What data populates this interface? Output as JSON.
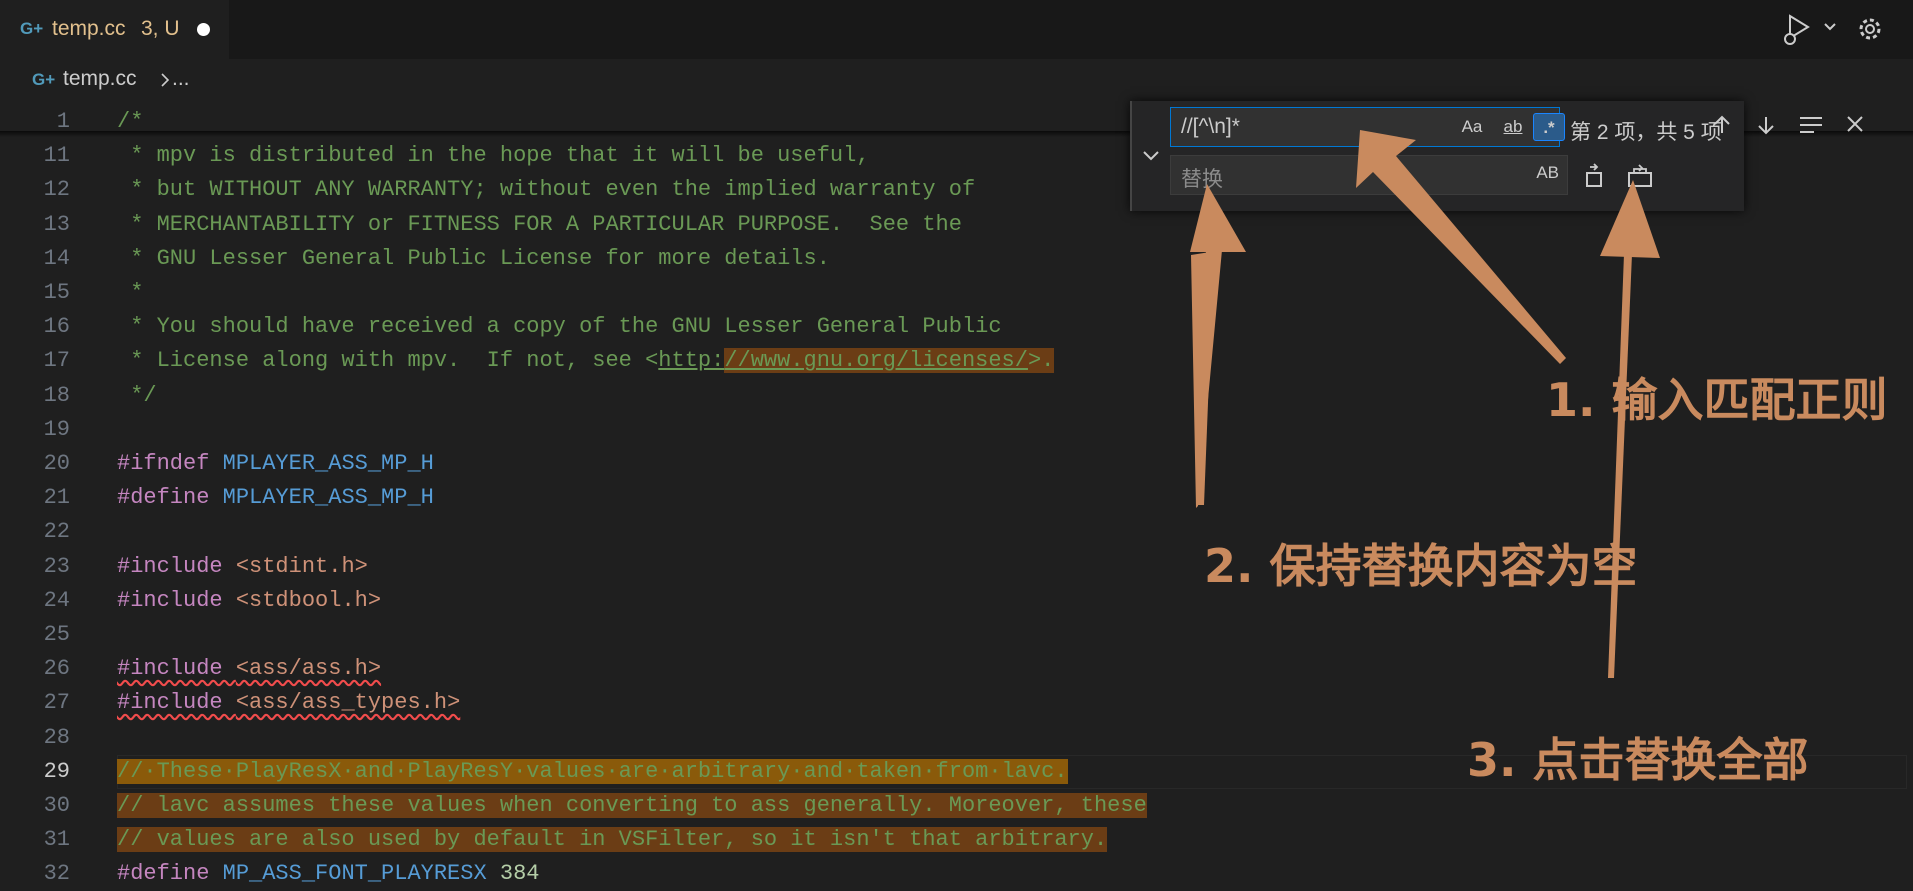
{
  "tab": {
    "icon": "C++-file-icon",
    "icon_glyph": "G+",
    "name": "temp.cc",
    "status": "3, U"
  },
  "breadcrumb": {
    "icon_glyph": "G+",
    "name": "temp.cc",
    "more": "..."
  },
  "lines": [
    {
      "n": "1",
      "segs": [
        {
          "t": "/*",
          "c": "c-com"
        }
      ]
    },
    {
      "n": "11",
      "segs": [
        {
          "t": " * mpv is distributed in the hope that it will be useful,",
          "c": "c-com"
        }
      ]
    },
    {
      "n": "12",
      "segs": [
        {
          "t": " * but WITHOUT ANY WARRANTY; without even the implied warranty of",
          "c": "c-com"
        }
      ]
    },
    {
      "n": "13",
      "segs": [
        {
          "t": " * MERCHANTABILITY or FITNESS FOR A PARTICULAR PURPOSE.  See the",
          "c": "c-com"
        }
      ]
    },
    {
      "n": "14",
      "segs": [
        {
          "t": " * GNU Lesser General Public License for more details.",
          "c": "c-com"
        }
      ]
    },
    {
      "n": "15",
      "segs": [
        {
          "t": " *",
          "c": "c-com"
        }
      ]
    },
    {
      "n": "16",
      "segs": [
        {
          "t": " * You should have received a copy of the GNU Lesser General Public",
          "c": "c-com"
        }
      ]
    },
    {
      "n": "17",
      "segs": [
        {
          "t": " * License along with mpv.  If not, see <",
          "c": "c-com"
        },
        {
          "t": "http:",
          "c": "c-com link"
        },
        {
          "t": "//www.gnu.org/licenses/",
          "c": "c-com link hl"
        },
        {
          "t": ">.",
          "c": "c-com hl"
        }
      ]
    },
    {
      "n": "18",
      "segs": [
        {
          "t": " */",
          "c": "c-com"
        }
      ]
    },
    {
      "n": "19",
      "segs": []
    },
    {
      "n": "20",
      "segs": [
        {
          "t": "#ifndef ",
          "c": "c-pp"
        },
        {
          "t": "MPLAYER_ASS_MP_H",
          "c": "c-mac"
        }
      ]
    },
    {
      "n": "21",
      "segs": [
        {
          "t": "#define ",
          "c": "c-pp"
        },
        {
          "t": "MPLAYER_ASS_MP_H",
          "c": "c-mac"
        }
      ]
    },
    {
      "n": "22",
      "segs": []
    },
    {
      "n": "23",
      "segs": [
        {
          "t": "#include ",
          "c": "c-pp"
        },
        {
          "t": "<stdint.h>",
          "c": "c-str"
        }
      ]
    },
    {
      "n": "24",
      "segs": [
        {
          "t": "#include ",
          "c": "c-pp"
        },
        {
          "t": "<stdbool.h>",
          "c": "c-str"
        }
      ]
    },
    {
      "n": "25",
      "segs": []
    },
    {
      "n": "26",
      "segs": [
        {
          "t": "#include ",
          "c": "c-pp squig"
        },
        {
          "t": "<ass/ass.h>",
          "c": "c-str squig"
        }
      ]
    },
    {
      "n": "27",
      "segs": [
        {
          "t": "#include ",
          "c": "c-pp squig"
        },
        {
          "t": "<ass/ass_types.h>",
          "c": "c-str squig"
        }
      ]
    },
    {
      "n": "28",
      "segs": []
    },
    {
      "n": "29",
      "current": true,
      "segs": [
        {
          "t": "//·These·PlayResX·and·PlayResY·values·are·arbitrary·and·taken·from·lavc.",
          "c": "c-com hl-cur"
        }
      ]
    },
    {
      "n": "30",
      "segs": [
        {
          "t": "// lavc assumes these values when converting to ass generally. Moreover, these",
          "c": "c-com hl"
        }
      ]
    },
    {
      "n": "31",
      "segs": [
        {
          "t": "// values are also used by default in VSFilter, so it isn't that arbitrary.",
          "c": "c-com hl"
        }
      ]
    },
    {
      "n": "32",
      "segs": [
        {
          "t": "#define ",
          "c": "c-pp"
        },
        {
          "t": "MP_ASS_FONT_PLAYRESX",
          "c": "c-mac"
        },
        {
          "t": " 384",
          "c": "c-num"
        }
      ]
    }
  ],
  "find": {
    "query": "//[^\\n]*",
    "case_label": "Aa",
    "word_label": "ab",
    "regex_label": ".*",
    "matches": "第 2 项，共 5 项",
    "replace_placeholder": "替换",
    "preserve_case_label": "AB"
  },
  "annotations": {
    "step1": "1. 输入匹配正则",
    "step2": "2. 保持替换内容为空",
    "step3": "3. 点击替换全部"
  },
  "colors": {
    "annotation": "#c98a5e",
    "comment": "#6a9955",
    "keyword": "#c586c0",
    "macro": "#569cd6",
    "string": "#ce9178"
  }
}
